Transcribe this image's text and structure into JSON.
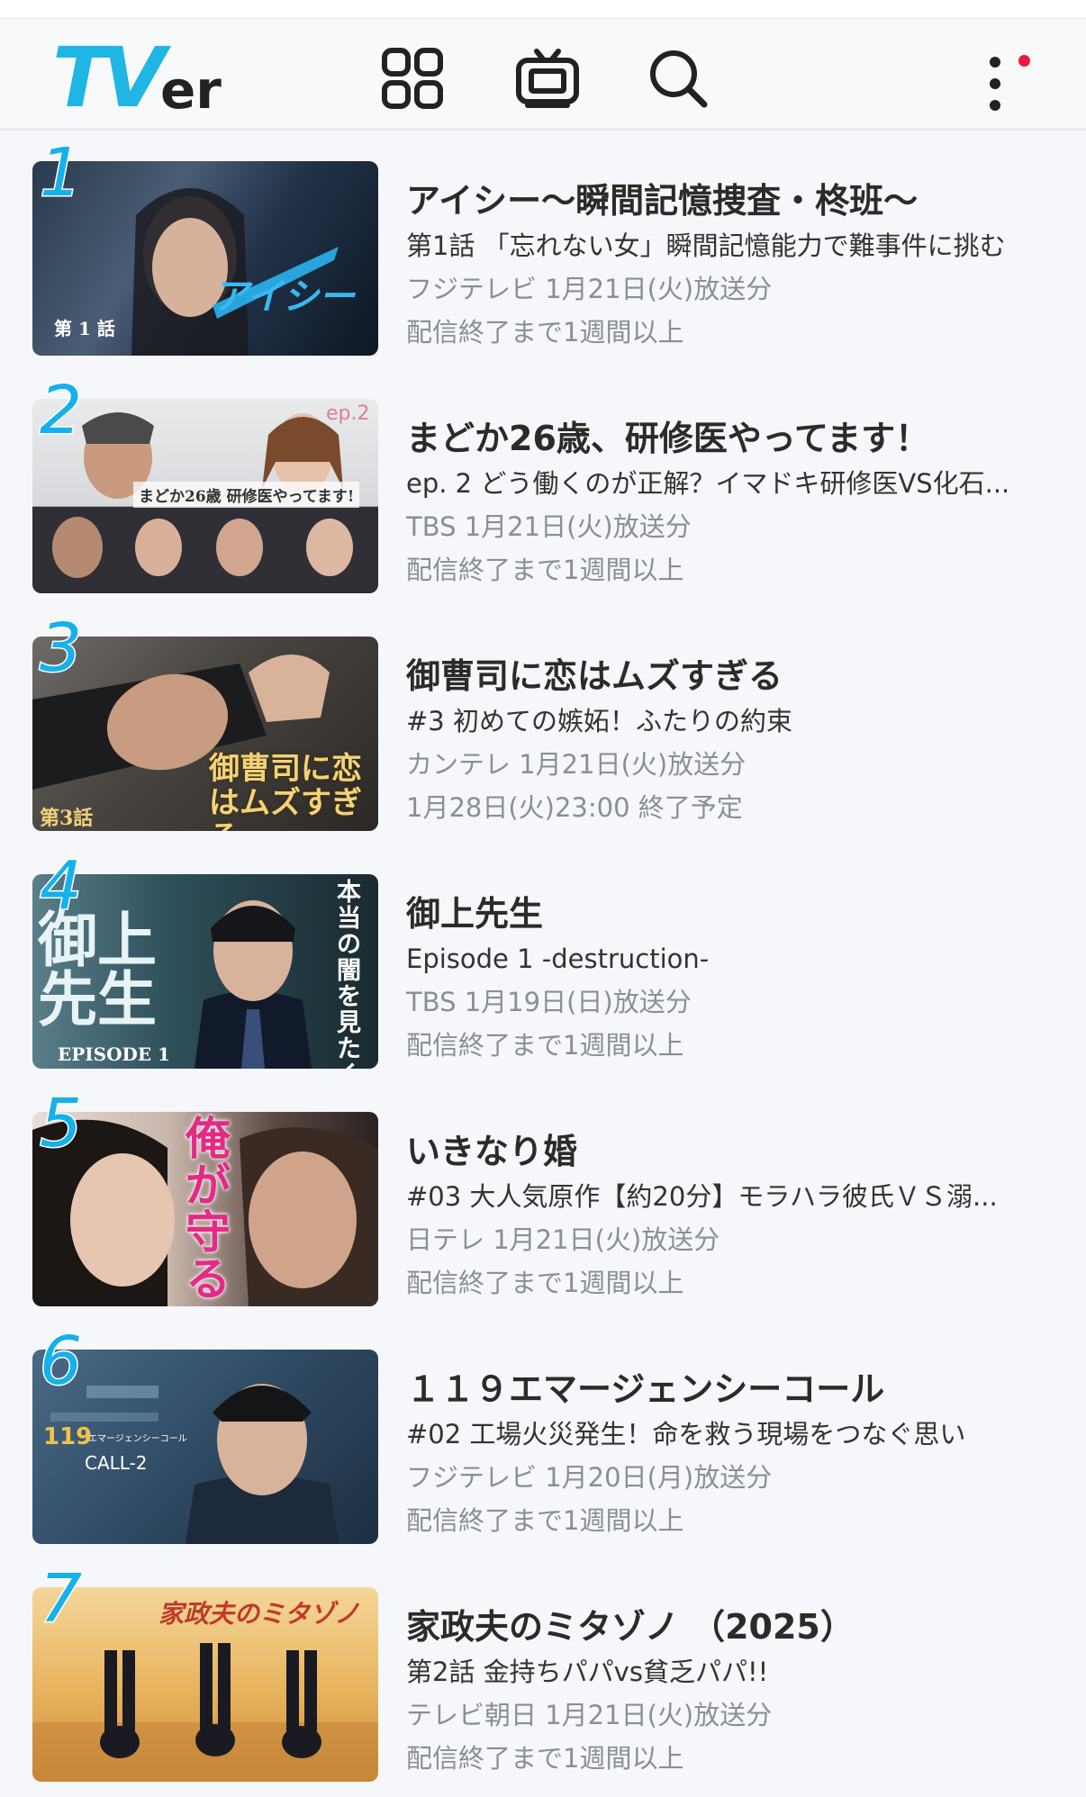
{
  "header": {
    "logo_tv": "TV",
    "logo_er": "er",
    "icons": [
      "grid-icon",
      "tv-icon",
      "search-icon",
      "more-vertical-icon"
    ],
    "notification_color": "#e8193c",
    "brand_color": "#1fb6e6"
  },
  "ranking": [
    {
      "rank": "1",
      "title": "アイシー〜瞬間記憶捜査・柊班〜",
      "subtitle": "第1話 「忘れない女」瞬間記憶能力で難事件に挑む",
      "broadcast": "フジテレビ 1月21日(火)放送分",
      "availability": "配信終了まで1週間以上",
      "thumb_caption": "第 1 話",
      "thumb_logo": "アイシー"
    },
    {
      "rank": "2",
      "title": "まどか26歳、研修医やってます！",
      "subtitle": "ep. 2 どう働くのが正解？イマドキ研修医VS化石...",
      "broadcast": "TBS 1月21日(火)放送分",
      "availability": "配信終了まで1週間以上",
      "thumb_caption": "まどか26歳 研修医やってます!",
      "thumb_badge": "ep.2"
    },
    {
      "rank": "3",
      "title": "御曹司に恋はムズすぎる",
      "subtitle": "#3 初めての嫉妬！ふたりの約束",
      "broadcast": "カンテレ 1月21日(火)放送分",
      "availability": "1月28日(火)23:00 終了予定",
      "thumb_caption": "御曹司に恋はムズすぎる",
      "thumb_badge": "第3話"
    },
    {
      "rank": "4",
      "title": "御上先生",
      "subtitle": "Episode 1 -destruction-",
      "broadcast": "TBS 1月19日(日)放送分",
      "availability": "配信終了まで1週間以上",
      "thumb_caption": "御上先生",
      "thumb_badge": "EPISODE 1",
      "thumb_vertical": "本当の闇を見たくないか？"
    },
    {
      "rank": "5",
      "title": "いきなり婚",
      "subtitle": "#03 大人気原作【約20分】モラハラ彼氏ＶＳ溺...",
      "broadcast": "日テレ 1月21日(火)放送分",
      "availability": "配信終了まで1週間以上",
      "thumb_caption": "俺が守る"
    },
    {
      "rank": "6",
      "title": "１１９エマージェンシーコール",
      "subtitle": "#02 工場火災発生！命を救う現場をつなぐ思い",
      "broadcast": "フジテレビ 1月20日(月)放送分",
      "availability": "配信終了まで1週間以上",
      "thumb_caption": "119",
      "thumb_badge": "CALL-2",
      "thumb_small": "エマージェンシーコール"
    },
    {
      "rank": "7",
      "title": "家政夫のミタゾノ （2025）",
      "subtitle": "第2話 金持ちパパvs貧乏パパ!!",
      "broadcast": "テレビ朝日 1月21日(火)放送分",
      "availability": "配信終了まで1週間以上",
      "thumb_caption": "家政夫のミタゾノ"
    }
  ]
}
